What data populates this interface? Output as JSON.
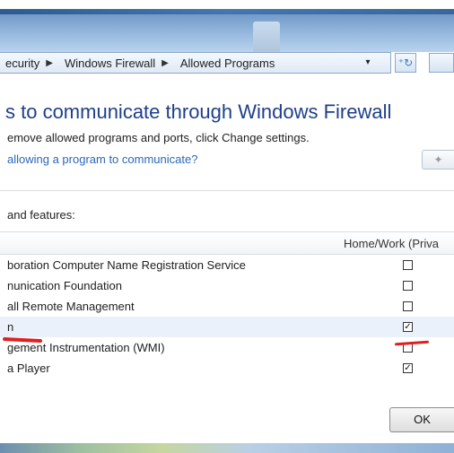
{
  "address_bar": {
    "crumbs": [
      "ecurity",
      "Windows Firewall",
      "Allowed Programs"
    ],
    "separator": "▶",
    "dropdown_icon": "▾",
    "refresh_icon": "⁺↻"
  },
  "content": {
    "heading": "s to communicate through Windows Firewall",
    "subtext": "emove allowed programs and ports, click Change settings.",
    "help_link": "allowing a program to communicate?",
    "change_settings_icon": "shield-icon",
    "list_label": " and features:"
  },
  "table": {
    "column_header": "Home/Work (Priva",
    "rows": [
      {
        "name": "boration Computer Name Registration Service",
        "checked": false
      },
      {
        "name": "nunication Foundation",
        "checked": false
      },
      {
        "name": "all Remote Management",
        "checked": false
      },
      {
        "name": "n",
        "checked": true,
        "selected": true
      },
      {
        "name": "gement Instrumentation (WMI)",
        "checked": false
      },
      {
        "name": "a Player",
        "checked": true
      }
    ]
  },
  "footer": {
    "ok_label": "OK"
  },
  "colors": {
    "heading": "#1e3f8a",
    "link": "#2a67b8",
    "annotation": "#e02020"
  }
}
